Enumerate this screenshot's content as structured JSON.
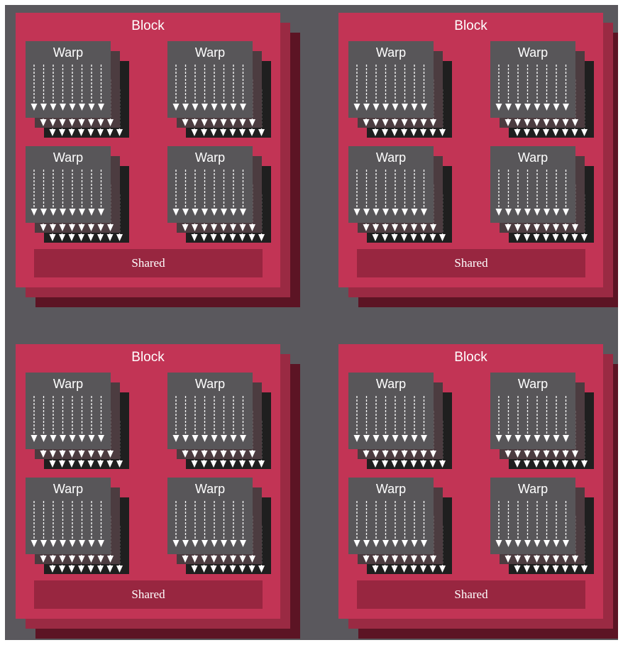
{
  "diagram": {
    "block_label": "Block",
    "warp_label": "Warp",
    "shared_label": "Shared",
    "blocks_count": 4,
    "warps_per_block": 4,
    "threads_per_warp": 8,
    "colors": {
      "background": "#5a585d",
      "block_front": "#c23455",
      "block_mid": "#9a2a43",
      "block_back": "#5c1424",
      "shared": "#982640",
      "warp_front": "#585659",
      "warp_mid": "#4c3c40",
      "warp_back": "#1f1f1f",
      "thread_arrow": "#ffffff"
    },
    "blocks": [
      {
        "title": "Block",
        "shared": "Shared",
        "warps": [
          "Warp",
          "Warp",
          "Warp",
          "Warp"
        ]
      },
      {
        "title": "Block",
        "shared": "Shared",
        "warps": [
          "Warp",
          "Warp",
          "Warp",
          "Warp"
        ]
      },
      {
        "title": "Block",
        "shared": "Shared",
        "warps": [
          "Warp",
          "Warp",
          "Warp",
          "Warp"
        ]
      },
      {
        "title": "Block",
        "shared": "Shared",
        "warps": [
          "Warp",
          "Warp",
          "Warp",
          "Warp"
        ]
      }
    ]
  }
}
